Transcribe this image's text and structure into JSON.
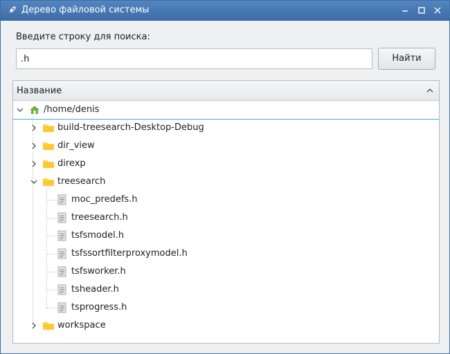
{
  "window": {
    "title": "Дерево файловой системы",
    "icon": "app-rocket-icon"
  },
  "search": {
    "label": "Введите строку для поиска:",
    "value": ".h",
    "button_label": "Найти"
  },
  "tree": {
    "column_header": "Название",
    "root": {
      "label": "/home/denis",
      "icon": "home-folder-icon",
      "expanded": true
    },
    "items": [
      {
        "label": "build-treesearch-Desktop-Debug",
        "type": "folder",
        "expanded": false
      },
      {
        "label": "dir_view",
        "type": "folder",
        "expanded": false
      },
      {
        "label": "direxp",
        "type": "folder",
        "expanded": false
      },
      {
        "label": "treesearch",
        "type": "folder",
        "expanded": true,
        "children": [
          {
            "label": "moc_predefs.h",
            "type": "file"
          },
          {
            "label": "treesearch.h",
            "type": "file"
          },
          {
            "label": "tsfsmodel.h",
            "type": "file"
          },
          {
            "label": "tsfssortfilterproxymodel.h",
            "type": "file"
          },
          {
            "label": "tsfsworker.h",
            "type": "file"
          },
          {
            "label": "tsheader.h",
            "type": "file"
          },
          {
            "label": "tsprogress.h",
            "type": "file"
          }
        ]
      },
      {
        "label": "workspace",
        "type": "folder",
        "expanded": false
      }
    ]
  },
  "colors": {
    "titlebar": "#3b6ca7",
    "selection_line": "#3daee9",
    "folder": "#fdd24f",
    "home": "#6cb33f"
  }
}
